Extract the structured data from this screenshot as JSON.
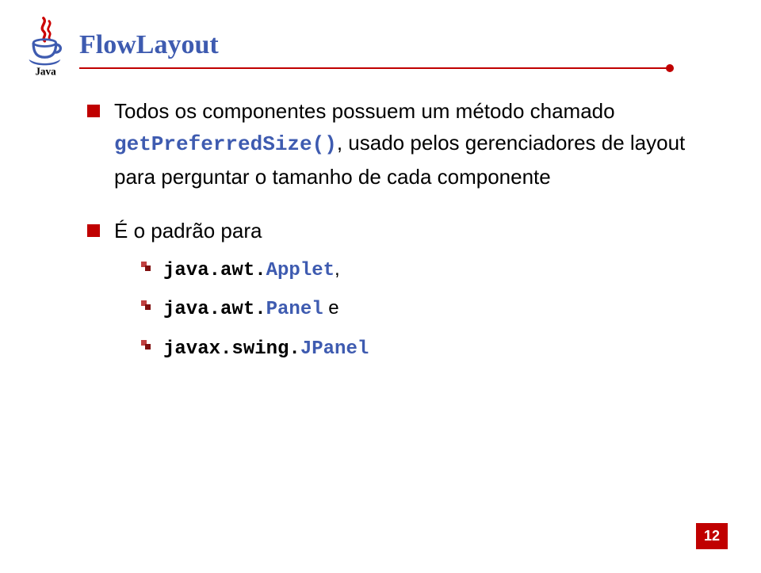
{
  "title": "FlowLayout",
  "items": [
    {
      "prefix": "Todos os componentes possuem um método chamado ",
      "code1": "getPreferredSize()",
      "suffix": ", usado pelos gerenciadores de layout para perguntar o tamanho de cada componente"
    },
    {
      "prefix": "É o padrão para",
      "code1": "",
      "suffix": ""
    }
  ],
  "subitems": [
    {
      "pkg": "java.awt.",
      "cls": "Applet",
      "tail": ","
    },
    {
      "pkg": "java.awt.",
      "cls": "Panel",
      "tail": " e"
    },
    {
      "pkg": "javax.swing.",
      "cls": "JPanel",
      "tail": ""
    }
  ],
  "page_number": "12",
  "logo_label": "Java"
}
